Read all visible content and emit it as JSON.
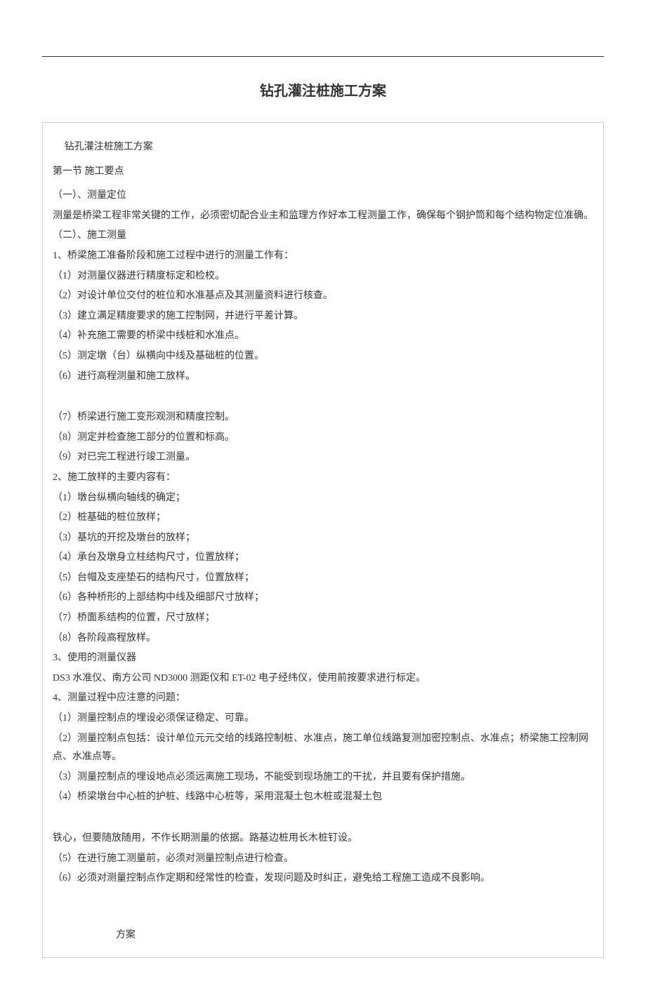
{
  "title": "钻孔灌注桩施工方案",
  "subtitle": "钻孔灌注桩施工方案",
  "section1": "第一节 施工要点",
  "s1_h1": "（一）、测量定位",
  "s1_p1": "测量是桥梁工程非常关键的工作，必须密切配合业主和监理方作好本工程测量工作，确保每个钢护筒和每个结构物定位准确。",
  "s1_h2": "（二）、施工测量",
  "s1_l1_head": "1、桥梁施工准备阶段和施工过程中进行的测量工作有：",
  "s1_l1_items": [
    "（1）对测量仪器进行精度标定和检校。",
    "（2）对设计单位交付的桩位和水准基点及其测量资料进行核查。",
    "（3）建立满足精度要求的施工控制网，并进行平差计算。",
    "（4）补充施工需要的桥梁中线桩和水准点。",
    "（5）测定墩（台）纵横向中线及基础桩的位置。",
    "（6）进行高程测量和施工放样。"
  ],
  "s1_l1_items_b": [
    "（7）桥梁进行施工变形观测和精度控制。",
    "（8）测定并检查施工部分的位置和标高。",
    "（9）对已完工程进行竣工测量。"
  ],
  "s1_l2_head": "2、施工放样的主要内容有：",
  "s1_l2_items": [
    "（1）墩台纵横向轴线的确定；",
    "（2）桩基础的桩位放样；",
    "（3）基坑的开挖及墩台的放样；",
    "（4）承台及墩身立柱结构尺寸，位置放样；",
    "（5）台帽及支座垫石的结构尺寸，位置放样；",
    "（6）各种桥形的上部结构中线及细部尺寸放样；",
    "（7）桥面系结构的位置，尺寸放样；",
    "（8）各阶段高程放样。"
  ],
  "s1_l3_head": "3、使用的测量仪器",
  "s1_l3_p": "DS3 水准仪、南方公司 ND3000 测距仪和 ET-02 电子经纬仪，使用前按要求进行标定。",
  "s1_l4_head": "4、测量过程中应注意的问题：",
  "s1_l4_items": [
    "（1）测量控制点的埋设必须保证稳定、可靠。",
    "（2）测量控制点包括：设计单位元元交给的线路控制桩、水准点，施工单位线路复测加密控制点、水准点；桥梁施工控制网点、水准点等。",
    "（3）测量控制点的埋设地点必须远离施工现场，不能受到现场施工的干扰，并且要有保护措施。",
    "（4）桥梁墩台中心桩的护桩、线路中心桩等，采用混凝土包木桩或混凝土包"
  ],
  "s1_l4_cont": "铁心，但要随放随用，不作长期测量的依据。路基边桩用长木桩钉设。",
  "s1_l4_items_b": [
    "（5）在进行施工测量前，必须对测量控制点进行检查。",
    "（6）必须对测量控制点作定期和经常性的检查，发现问题及时纠正，避免给工程施工造成不良影响。"
  ],
  "footer": "方案"
}
